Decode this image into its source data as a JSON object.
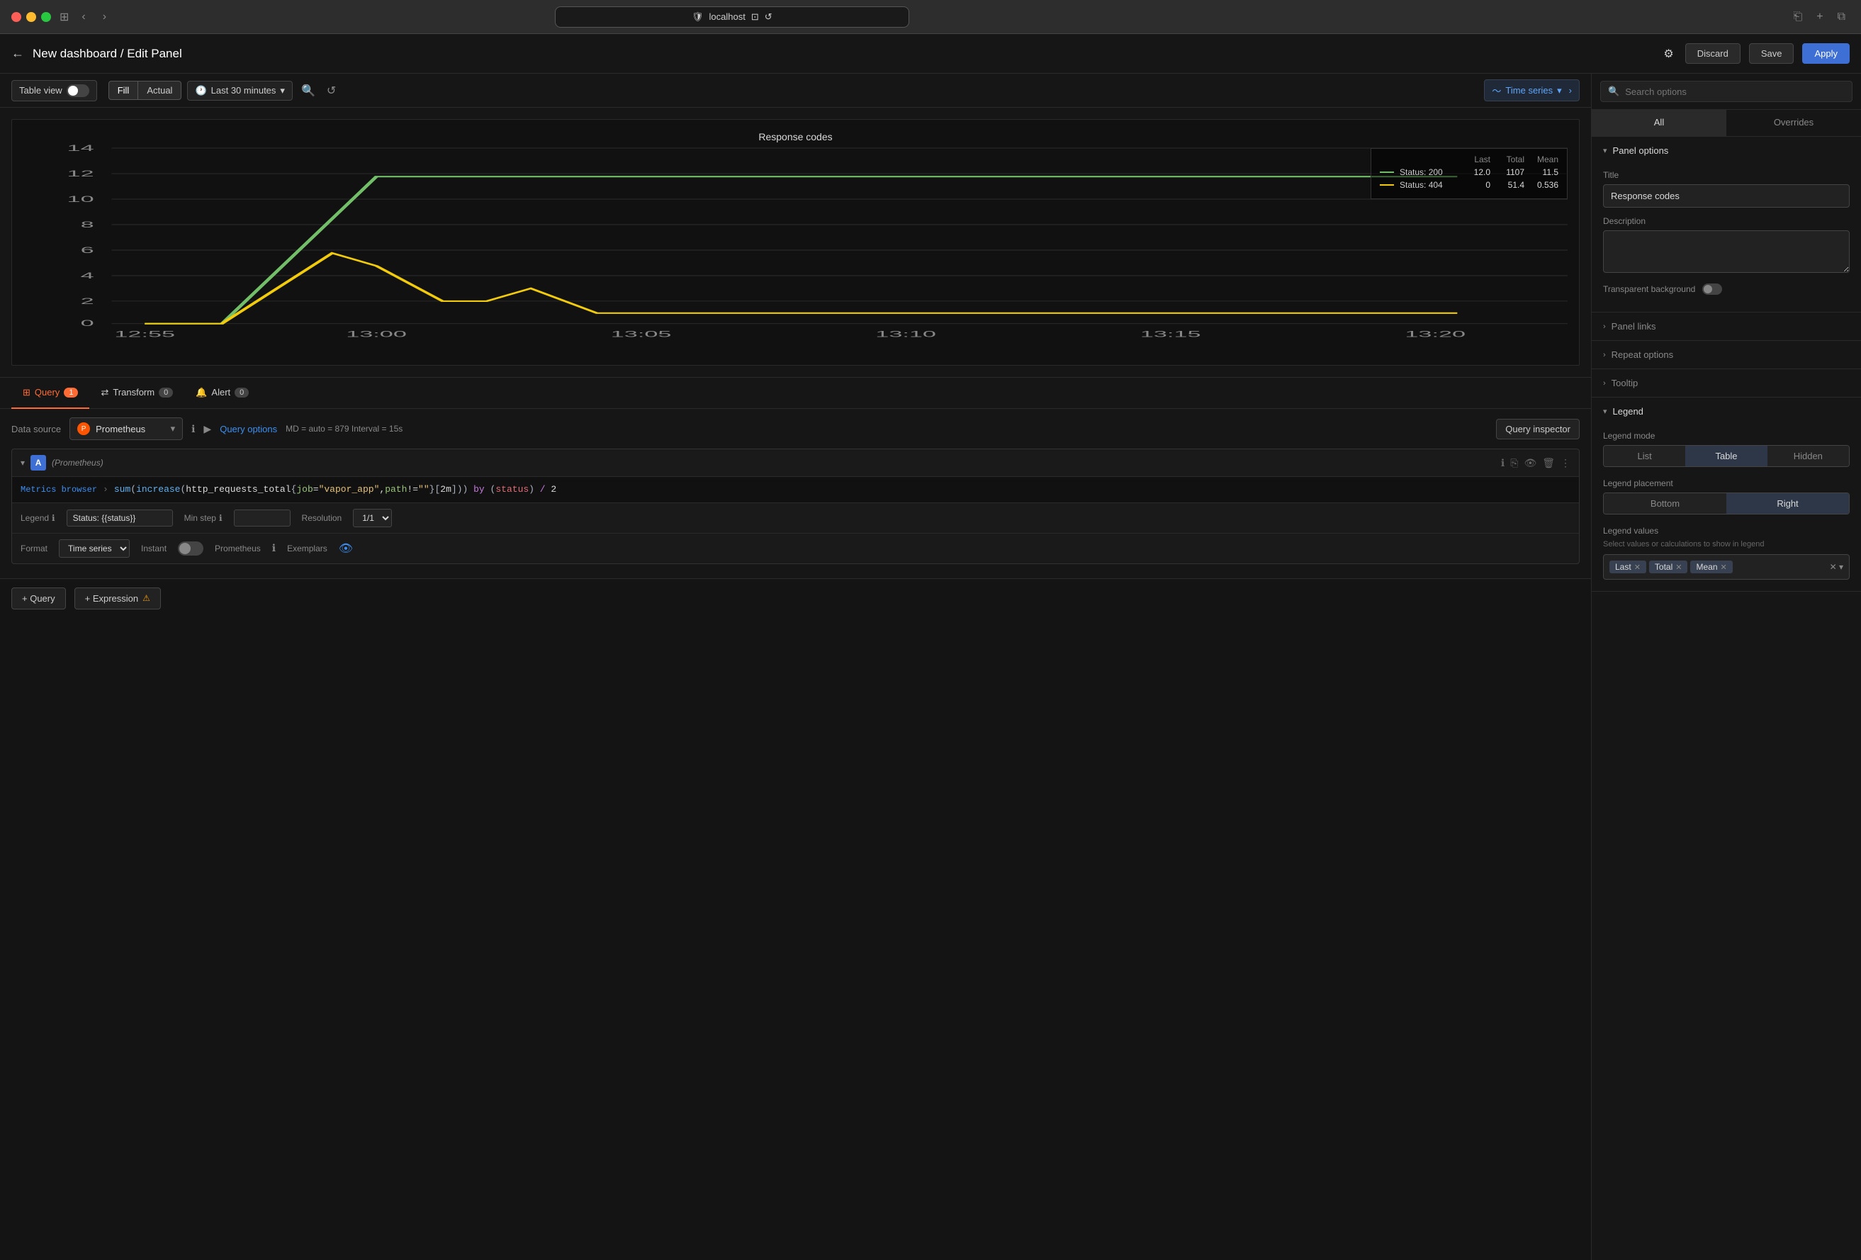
{
  "browser": {
    "url": "localhost",
    "traffic_lights": [
      "red",
      "yellow",
      "green"
    ]
  },
  "topbar": {
    "back_label": "←",
    "title": "New dashboard / Edit Panel",
    "gear_label": "⚙",
    "discard_label": "Discard",
    "save_label": "Save",
    "apply_label": "Apply"
  },
  "chart_toolbar": {
    "table_view_label": "Table view",
    "fill_label": "Fill",
    "actual_label": "Actual",
    "time_label": "Last 30 minutes",
    "panel_type_label": "Time series"
  },
  "chart": {
    "title": "Response codes",
    "y_labels": [
      "14",
      "12",
      "10",
      "8",
      "6",
      "4",
      "2",
      "0"
    ],
    "x_labels": [
      "12:55",
      "13:00",
      "13:05",
      "13:10",
      "13:15",
      "13:20"
    ],
    "legend": {
      "headers": [
        "Last",
        "Total",
        "Mean"
      ],
      "rows": [
        {
          "color": "#73bf69",
          "label": "Status: 200",
          "last": "12.0",
          "total": "1107",
          "mean": "11.5"
        },
        {
          "color": "#f2cc0c",
          "label": "Status: 404",
          "last": "0",
          "total": "51.4",
          "mean": "0.536"
        }
      ]
    }
  },
  "tabs": {
    "query": {
      "label": "Query",
      "badge": "1"
    },
    "transform": {
      "label": "Transform",
      "badge": "0"
    },
    "alert": {
      "label": "Alert",
      "badge": "0"
    }
  },
  "query_panel": {
    "data_source_label": "Data source",
    "data_source_name": "Prometheus",
    "query_options_label": "Query options",
    "query_options_info": "MD = auto = 879   Interval = 15s",
    "query_inspector_label": "Query inspector",
    "query_a": {
      "letter": "A",
      "ds_name": "(Prometheus)",
      "metrics_browser": "Metrics browser",
      "query_code": "sum(increase(http_requests_total{job=\"vapor_app\",path!=\"\"}[2m])) by (status) / 2",
      "legend_label": "Legend",
      "legend_value": "Status: {{status}}",
      "min_step_label": "Min step",
      "resolution_label": "Resolution",
      "resolution_value": "1/1",
      "format_label": "Format",
      "format_value": "Time series",
      "instant_label": "Instant",
      "prometheus_label": "Prometheus",
      "exemplars_label": "Exemplars"
    }
  },
  "add_query": {
    "query_label": "+ Query",
    "expression_label": "+ Expression"
  },
  "right_panel": {
    "search_placeholder": "Search options",
    "tabs": {
      "all": "All",
      "overrides": "Overrides"
    },
    "panel_options": {
      "title_label": "Panel options",
      "title_field": "Title",
      "title_value": "Response codes",
      "description_label": "Description",
      "description_value": "",
      "transparent_label": "Transparent background"
    },
    "panel_links": {
      "label": "Panel links"
    },
    "repeat_options": {
      "label": "Repeat options"
    },
    "tooltip": {
      "label": "Tooltip"
    },
    "legend": {
      "label": "Legend",
      "mode_label": "Legend mode",
      "mode_options": [
        "List",
        "Table",
        "Hidden"
      ],
      "mode_active": "Table",
      "placement_label": "Legend placement",
      "placement_options": [
        "Bottom",
        "Right"
      ],
      "placement_active": "Right",
      "values_label": "Legend values",
      "values_description": "Select values or calculations to show in legend",
      "values_tags": [
        "Last",
        "Total",
        "Mean"
      ]
    }
  }
}
